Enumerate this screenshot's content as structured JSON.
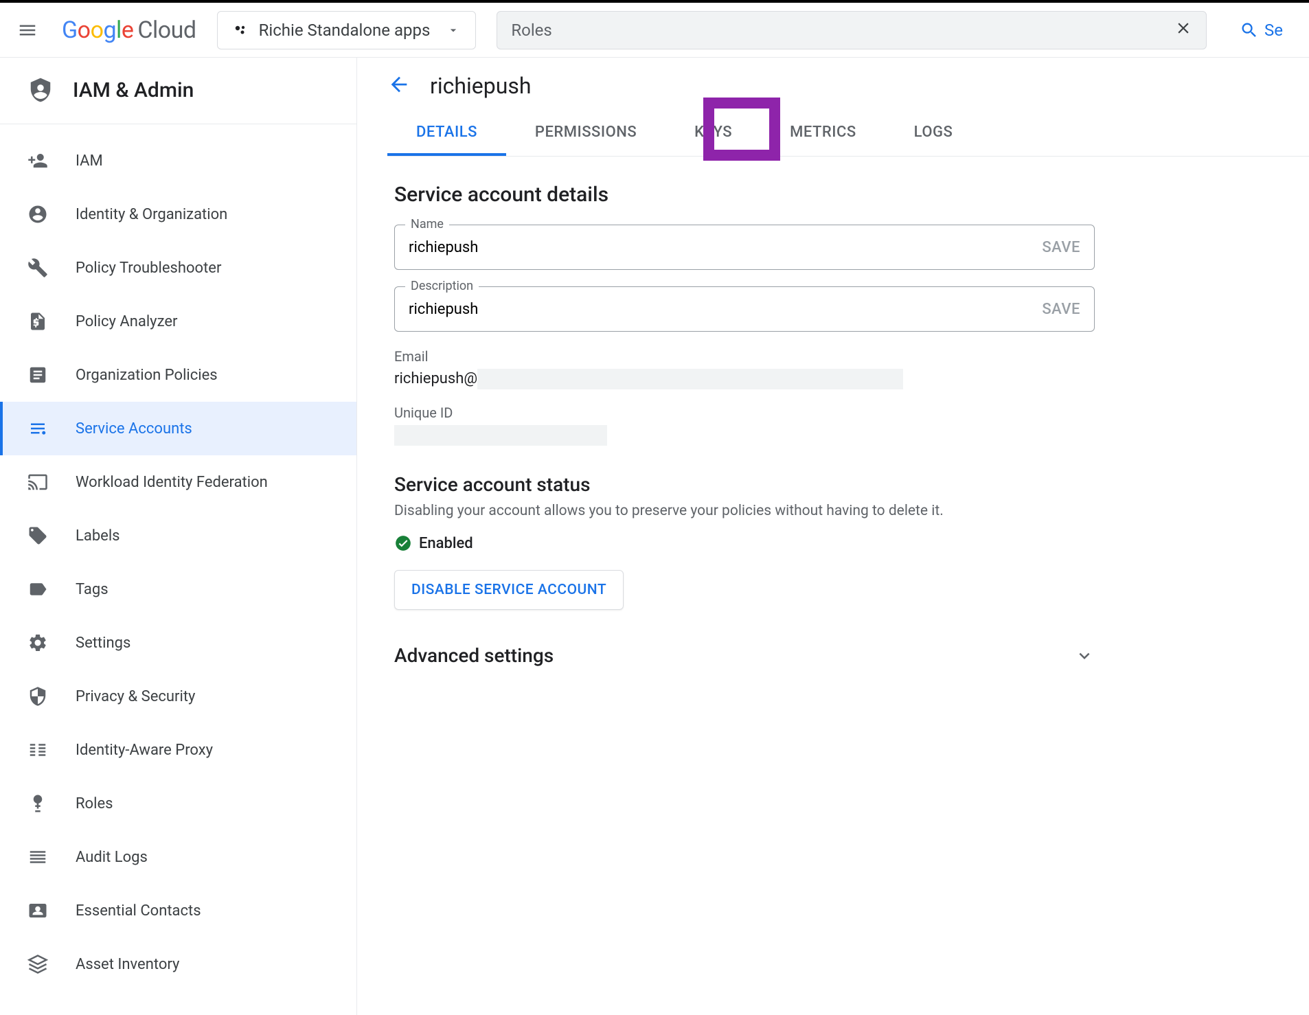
{
  "header": {
    "logo_text": "Cloud",
    "project_name": "Richie Standalone apps",
    "search_value": "Roles",
    "search_action": "Se"
  },
  "sidebar": {
    "title": "IAM & Admin",
    "items": [
      {
        "label": "IAM"
      },
      {
        "label": "Identity & Organization"
      },
      {
        "label": "Policy Troubleshooter"
      },
      {
        "label": "Policy Analyzer"
      },
      {
        "label": "Organization Policies"
      },
      {
        "label": "Service Accounts"
      },
      {
        "label": "Workload Identity Federation"
      },
      {
        "label": "Labels"
      },
      {
        "label": "Tags"
      },
      {
        "label": "Settings"
      },
      {
        "label": "Privacy & Security"
      },
      {
        "label": "Identity-Aware Proxy"
      },
      {
        "label": "Roles"
      },
      {
        "label": "Audit Logs"
      },
      {
        "label": "Essential Contacts"
      },
      {
        "label": "Asset Inventory"
      }
    ]
  },
  "page": {
    "title": "richiepush",
    "tabs": [
      {
        "label": "DETAILS"
      },
      {
        "label": "PERMISSIONS"
      },
      {
        "label": "KEYS"
      },
      {
        "label": "METRICS"
      },
      {
        "label": "LOGS"
      }
    ],
    "details_heading": "Service account details",
    "name_field": {
      "label": "Name",
      "value": "richiepush",
      "action": "SAVE"
    },
    "desc_field": {
      "label": "Description",
      "value": "richiepush",
      "action": "SAVE"
    },
    "email_label": "Email",
    "email_value": "richiepush@",
    "uniqueid_label": "Unique ID",
    "status_heading": "Service account status",
    "status_desc": "Disabling your account allows you to preserve your policies without having to delete it.",
    "status_value": "Enabled",
    "disable_btn": "DISABLE SERVICE ACCOUNT",
    "advanced_heading": "Advanced settings"
  }
}
